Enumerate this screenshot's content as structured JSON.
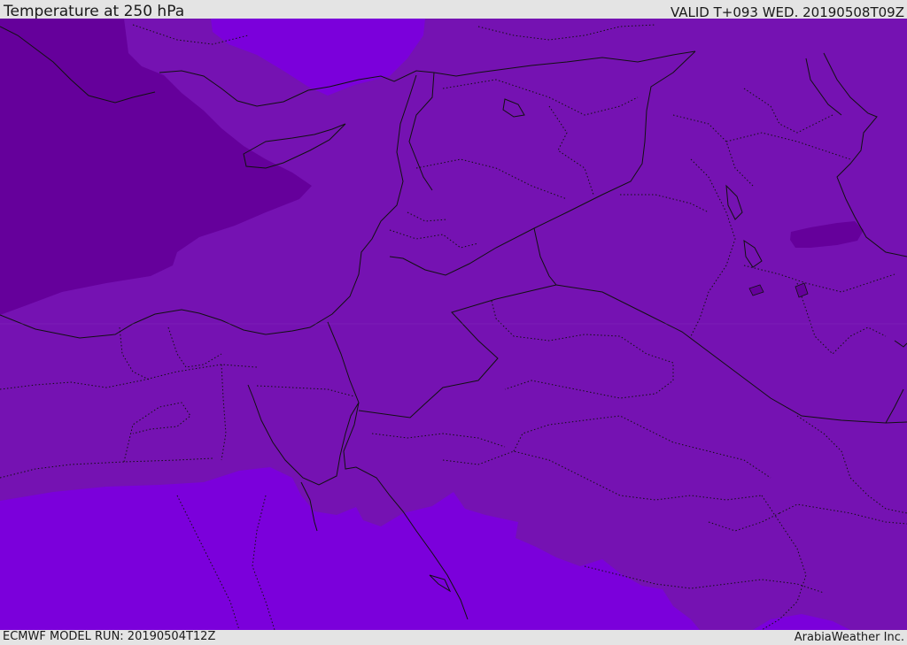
{
  "header": {
    "title": "Temperature at 250 hPa",
    "valid": "VALID T+093 WED. 20190508T09Z"
  },
  "footer": {
    "model_run": "ECMWF MODEL RUN: 20190504T12Z",
    "credit": "ArabiaWeather Inc."
  },
  "colors": {
    "dark_band": "#65009b",
    "mid_band": "#7512b2",
    "light_band": "#7b00db",
    "coastline": "#111111",
    "bar_background": "#e4e4e4"
  }
}
